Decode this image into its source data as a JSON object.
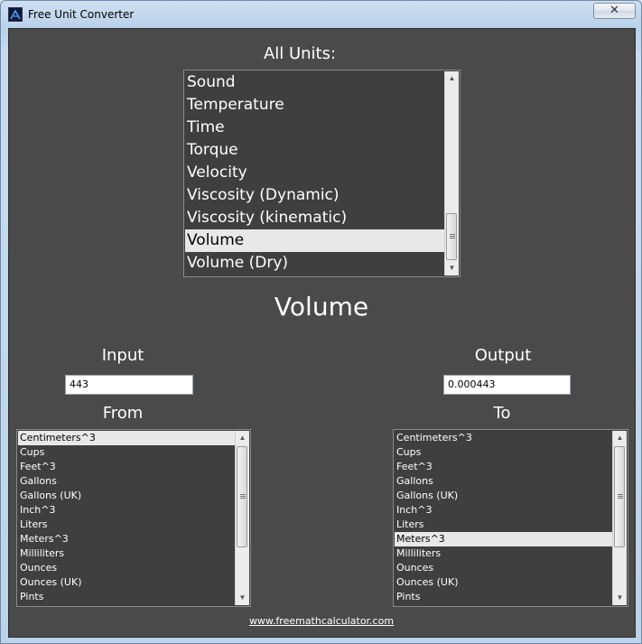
{
  "window": {
    "title": "Free Unit Converter",
    "close_label": "✕"
  },
  "categories": {
    "label": "All Units:",
    "items": [
      "Sound",
      "Temperature",
      "Time",
      "Torque",
      "Velocity",
      "Viscosity (Dynamic)",
      "Viscosity (kinematic)",
      "Volume",
      "Volume (Dry)"
    ],
    "selected": "Volume"
  },
  "selected_category_heading": "Volume",
  "input": {
    "label": "Input",
    "value": "443"
  },
  "output": {
    "label": "Output",
    "value": "0.000443"
  },
  "from": {
    "label": "From",
    "items": [
      "Centimeters^3",
      "Cups",
      "Feet^3",
      "Gallons",
      "Gallons (UK)",
      "Inch^3",
      "Liters",
      "Meters^3",
      "Milliliters",
      "Ounces",
      "Ounces (UK)",
      "Pints"
    ],
    "selected": "Centimeters^3"
  },
  "to": {
    "label": "To",
    "items": [
      "Centimeters^3",
      "Cups",
      "Feet^3",
      "Gallons",
      "Gallons (UK)",
      "Inch^3",
      "Liters",
      "Meters^3",
      "Milliliters",
      "Ounces",
      "Ounces (UK)",
      "Pints"
    ],
    "selected": "Meters^3"
  },
  "footer": {
    "link_text": "www.freemathcalculator.com"
  }
}
